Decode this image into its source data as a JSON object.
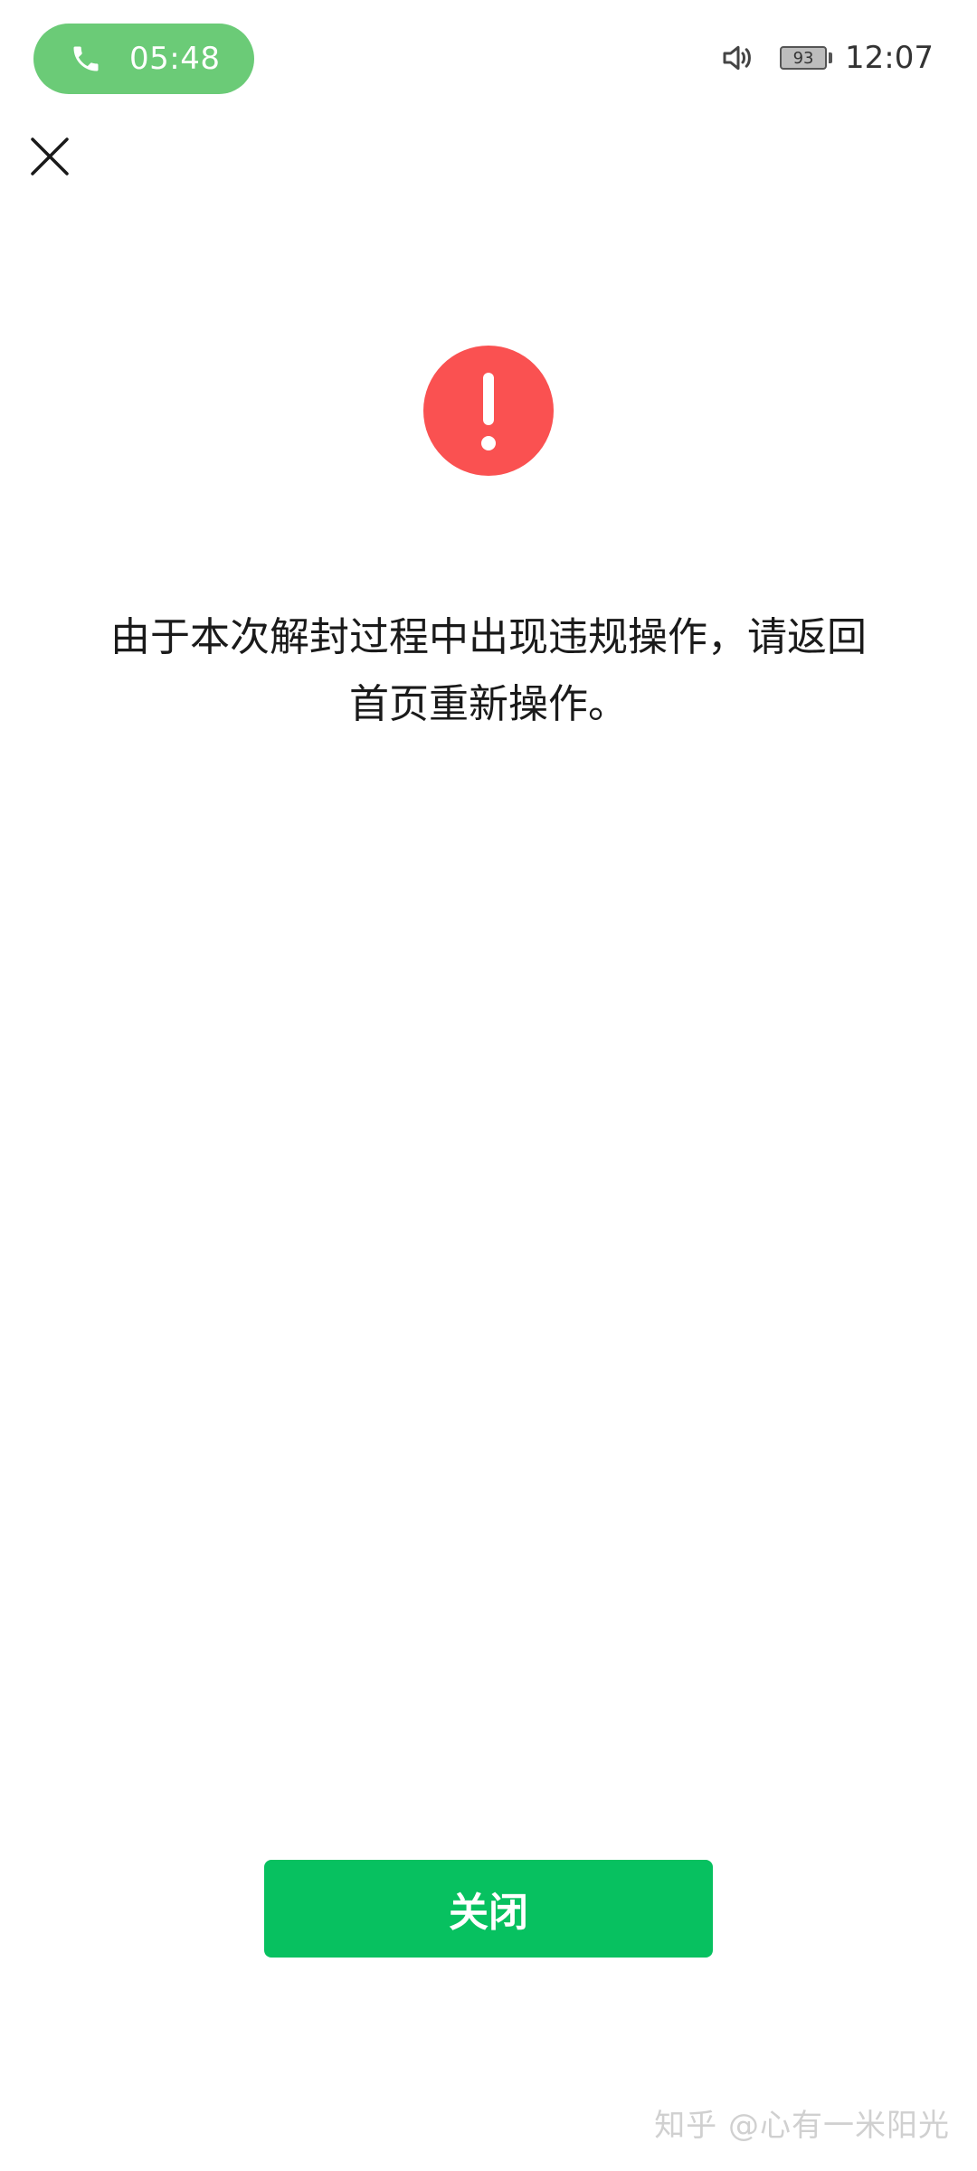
{
  "status_bar": {
    "call_duration": "05:48",
    "battery_level": "93",
    "time": "12:07",
    "call_pill_color": "#6bcb77"
  },
  "icons": {
    "phone": "phone-icon",
    "volume": "volume-icon",
    "battery": "battery-icon",
    "close": "close-icon",
    "warning": "exclamation-icon"
  },
  "dialog": {
    "message_line1": "由于本次解封过程中出现违规操作，请返回",
    "message_line2": "首页重新操作。",
    "warning_color": "#fa5151",
    "close_button_label": "关闭",
    "close_button_color": "#07c160"
  },
  "watermark": {
    "text": "知乎 @心有一米阳光"
  }
}
